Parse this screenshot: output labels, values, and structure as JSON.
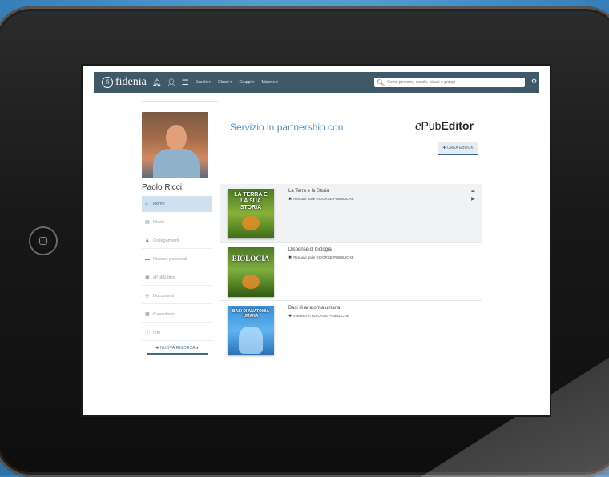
{
  "navbar": {
    "logo_mark": "fi",
    "brand": "fidenia",
    "icons": [
      "bell-icon",
      "user-icon",
      "menu-icon"
    ],
    "menus": [
      "Scuole ▾",
      "Classi ▾",
      "Gruppi ▾",
      "Materie ▾"
    ],
    "search_placeholder": "Cerca persone, scuole, classi e gruppi",
    "accent": "#3f5969"
  },
  "sidebar": {
    "username": "Paolo Ricci",
    "items": [
      {
        "label": "Home",
        "icon": "home-icon"
      },
      {
        "label": "Diario",
        "icon": "book-icon"
      },
      {
        "label": "Collegamenti",
        "icon": "user-icon"
      },
      {
        "label": "Risorse personali",
        "icon": "folder-icon"
      },
      {
        "label": "ePubEditor",
        "icon": "file-icon"
      },
      {
        "label": "Documenti",
        "icon": "document-icon"
      },
      {
        "label": "Calendario",
        "icon": "calendar-icon"
      },
      {
        "label": "Info",
        "icon": "info-icon"
      }
    ],
    "cta": "✚ NUOVA RISORSA ▾"
  },
  "main": {
    "partner_title": "Servizio in partnership con",
    "epub_logo_e": "e",
    "epub_logo_pub": "Pub",
    "epub_logo_editor": "Editor",
    "cta_button": "✚ CREA EBOOK"
  },
  "books": [
    {
      "cover_text": "LA TERRA E LA SUA STORIA",
      "title": "La Terra e la Storia",
      "subtitle": "Rimuovi dalle RISORSE PUBBLICHE",
      "mark": "✖"
    },
    {
      "cover_text": "BIOLOGIA",
      "title": "Dispense di biologia",
      "subtitle": "Rimuovi dalle RISORSE PUBBLICHE",
      "mark": "✖"
    },
    {
      "cover_text": "BASI DI ANATOMIA UMANA",
      "title": "Basi di anatomia umana",
      "subtitle": "Inserisci in RISORSE PUBBLICHE",
      "mark": "✚"
    }
  ]
}
